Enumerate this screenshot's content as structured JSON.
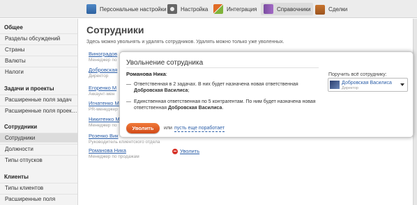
{
  "topnav": {
    "items": [
      {
        "label": "Персональные настройки",
        "icon": "people-icon"
      },
      {
        "label": "Настройка",
        "icon": "gear-icon"
      },
      {
        "label": "Интеграция",
        "icon": "arrows-icon"
      },
      {
        "label": "Справочники",
        "icon": "book-icon"
      },
      {
        "label": "Сделки",
        "icon": "case-icon"
      }
    ]
  },
  "sidebar": {
    "sections": [
      {
        "title": "Общее",
        "items": [
          "Разделы обсуждений",
          "Страны",
          "Валюты",
          "Налоги"
        ]
      },
      {
        "title": "Задачи и проекты",
        "items": [
          "Расширенные поля задач",
          "Расширенные поля проек…"
        ]
      },
      {
        "title": "Сотрудники",
        "items": [
          "Сотрудники",
          "Должности",
          "Типы отпусков"
        ]
      },
      {
        "title": "Клиенты",
        "items": [
          "Типы клиентов",
          "Расширенные поля"
        ]
      }
    ]
  },
  "main": {
    "title": "Сотрудники",
    "description": "Здесь можно увольнять и удалять сотрудников. Удалять можно только уже уволенных.",
    "employees": [
      {
        "name": "Виноградов",
        "position": "Менеджер по"
      },
      {
        "name": "Добровская",
        "position": "Директор"
      },
      {
        "name": "Егоренко М",
        "position": "Аккаунт-мен"
      },
      {
        "name": "Игнатенко М",
        "position": "PR-менеджер"
      },
      {
        "name": "Никитенко М",
        "position": "Менеджер по"
      },
      {
        "name": "Розенко Вик",
        "position": "Руководитель клиентского отдела"
      },
      {
        "name": "Романова Ника",
        "position": "Менеджер по продажам"
      }
    ],
    "fire_link": "Уволить"
  },
  "modal": {
    "title": "Увольнение сотрудника",
    "employee": "Романова Ника",
    "point1_text": "Ответственная в 2 задачах. В них будет назначена новая ответственная",
    "point1_bold": "Добровская Василиса",
    "point2_text": "Единственная ответственная по 5 контрагентам. По ним будет назначена новая ответственная",
    "point2_bold": "Добровская Василиса",
    "fire_button": "Уволить",
    "or": "или",
    "keep_link": "пусть еще поработает",
    "assign_label": "Поручить всё сотруднику:",
    "assign_name": "Добровская Василиса",
    "assign_position": "Директор"
  }
}
